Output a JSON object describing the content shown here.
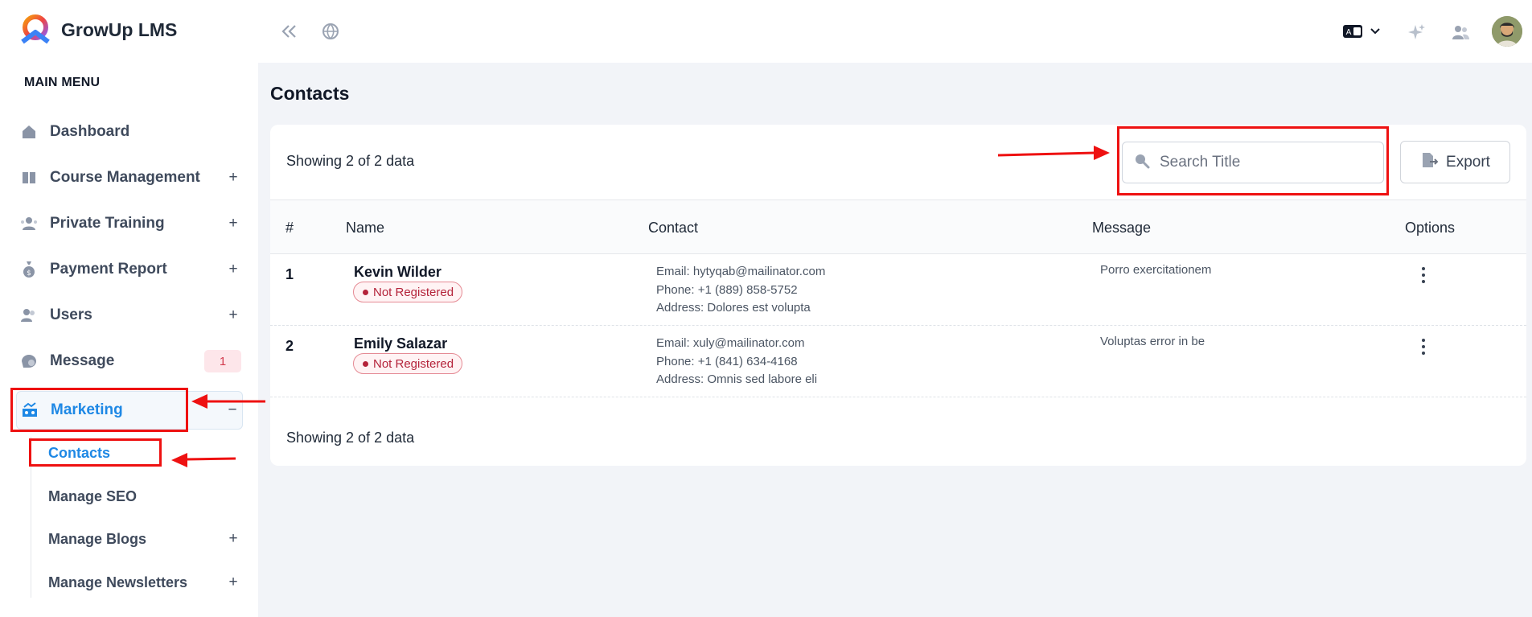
{
  "app": {
    "name": "GrowUp LMS"
  },
  "sidebar": {
    "heading": "MAIN MENU",
    "items": [
      {
        "label": "Dashboard",
        "icon": "home-icon",
        "expandable": false
      },
      {
        "label": "Course Management",
        "icon": "book-icon",
        "expandable": true,
        "toggle": "+"
      },
      {
        "label": "Private Training",
        "icon": "training-icon",
        "expandable": true,
        "toggle": "+"
      },
      {
        "label": "Payment Report",
        "icon": "money-bag-icon",
        "expandable": true,
        "toggle": "+"
      },
      {
        "label": "Users",
        "icon": "users-icon",
        "expandable": true,
        "toggle": "+"
      },
      {
        "label": "Message",
        "icon": "message-icon",
        "badge": "1"
      },
      {
        "label": "Marketing",
        "icon": "marketing-icon",
        "expandable": true,
        "toggle": "−",
        "active": true
      }
    ],
    "submenu": [
      {
        "label": "Contacts",
        "active": true
      },
      {
        "label": "Manage SEO"
      },
      {
        "label": "Manage Blogs",
        "toggle": "+"
      },
      {
        "label": "Manage Newsletters",
        "toggle": "+"
      }
    ]
  },
  "header": {
    "icons": [
      "collapse-icon",
      "globe-icon",
      "language-icon",
      "chevron-down-icon",
      "sparkle-icon",
      "user-group-icon",
      "avatar"
    ]
  },
  "main": {
    "title": "Contacts",
    "showing_top": "Showing 2 of 2 data",
    "showing_bottom": "Showing 2 of 2 data",
    "search": {
      "placeholder": "Search Title",
      "value": ""
    },
    "export_label": "Export",
    "columns": [
      "#",
      "Name",
      "Contact",
      "Message",
      "Options"
    ],
    "rows": [
      {
        "num": "1",
        "name": "Kevin Wilder",
        "status": "Not Registered",
        "email": "Email: hytyqab@mailinator.com",
        "phone": "Phone: +1 (889) 858-5752",
        "address": "Address: Dolores est volupta",
        "message": "Porro exercitationem"
      },
      {
        "num": "2",
        "name": "Emily Salazar",
        "status": "Not Registered",
        "email": "Email: xuly@mailinator.com",
        "phone": "Phone: +1 (841) 634-4168",
        "address": "Address: Omnis sed labore eli",
        "message": "Voluptas error in be"
      }
    ]
  },
  "colors": {
    "accent": "#1e88e5",
    "annotation_red": "#ee1111",
    "status_red": "#b4233a",
    "background": "#f2f4f8"
  }
}
